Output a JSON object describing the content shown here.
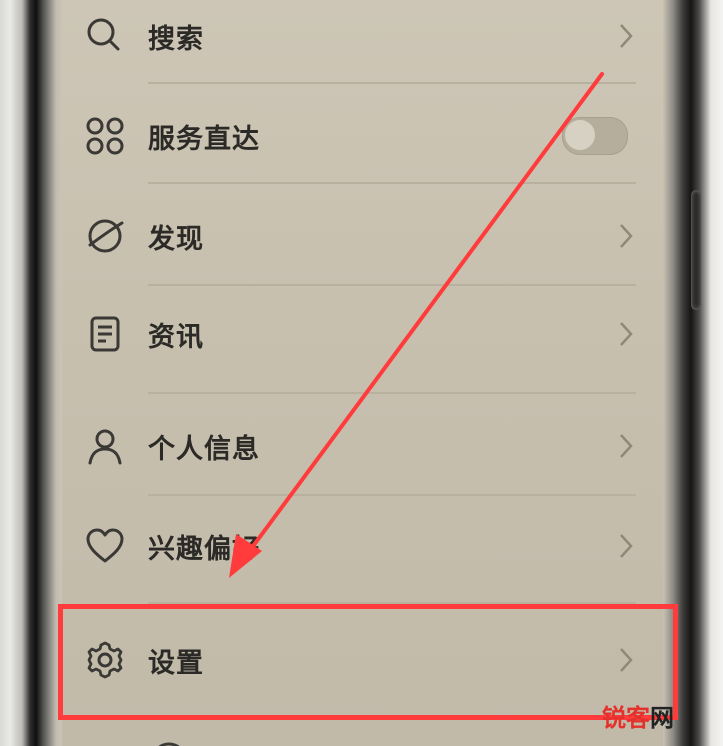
{
  "menu": {
    "items": [
      {
        "key": "search",
        "label": "搜索",
        "icon": "search-icon",
        "trailing": "chevron"
      },
      {
        "key": "services",
        "label": "服务直达",
        "icon": "grid-icon",
        "trailing": "toggle",
        "toggle_on": false
      },
      {
        "key": "discover",
        "label": "发现",
        "icon": "planet-icon",
        "trailing": "chevron"
      },
      {
        "key": "news",
        "label": "资讯",
        "icon": "document-icon",
        "trailing": "chevron"
      },
      {
        "key": "profile",
        "label": "个人信息",
        "icon": "person-icon",
        "trailing": "chevron"
      },
      {
        "key": "interests",
        "label": "兴趣偏好",
        "icon": "heart-icon",
        "trailing": "chevron"
      },
      {
        "key": "settings",
        "label": "设置",
        "icon": "gear-icon",
        "trailing": "chevron",
        "highlighted": true
      }
    ]
  },
  "annotation": {
    "arrow_color": "#ff3b3b",
    "box_color": "#ff3b3b"
  },
  "watermark": {
    "part1": "锐",
    "part2": "客",
    "part3": "网"
  },
  "colors": {
    "screen_bg": "#c8c0af",
    "text": "#2b2a27",
    "icon": "#3a3935",
    "chevron": "#8f887b",
    "highlight": "#ff3b3b"
  }
}
